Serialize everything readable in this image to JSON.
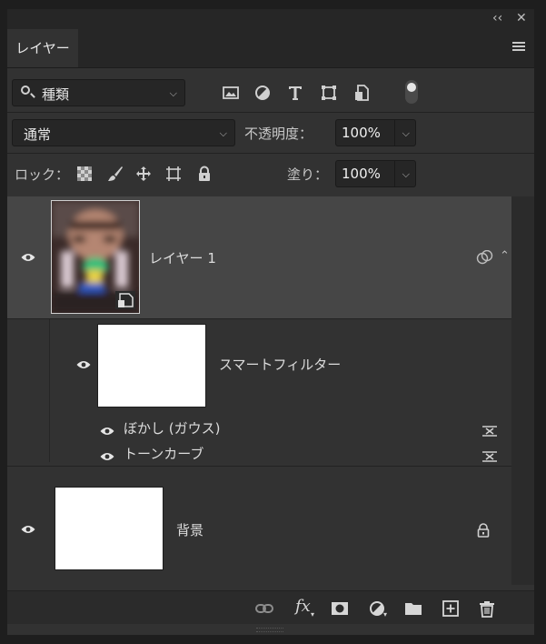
{
  "window": {
    "collapse_glyph": "‹‹",
    "close_glyph": "✕"
  },
  "tab": {
    "label": "レイヤー"
  },
  "filter": {
    "kind_label": "種類",
    "icons": [
      "image-filter-icon",
      "adjustment-filter-icon",
      "type-filter-icon",
      "shape-filter-icon",
      "smart-object-filter-icon"
    ]
  },
  "blend": {
    "mode": "通常",
    "opacity_label": "不透明度：",
    "opacity_value": "100%"
  },
  "lock": {
    "label": "ロック：",
    "fill_label": "塗り：",
    "fill_value": "100%",
    "icons": [
      "lock-transparent-pixels-icon",
      "lock-image-pixels-icon",
      "lock-position-icon",
      "lock-artboard-icon",
      "lock-all-icon"
    ]
  },
  "layers": [
    {
      "name": "レイヤー 1",
      "visible": true,
      "type": "smart-object",
      "selected": true
    },
    {
      "name": "スマートフィルター",
      "visible": true,
      "type": "smart-filter-mask"
    },
    {
      "name": "ぼかし (ガウス)",
      "visible": true,
      "type": "filter"
    },
    {
      "name": "トーンカーブ",
      "visible": true,
      "type": "filter"
    },
    {
      "name": "背景",
      "visible": true,
      "type": "background",
      "locked": true
    }
  ],
  "bottom_bar": {
    "fx_label": "fx",
    "icons": [
      "link-layers-icon",
      "fx-icon",
      "add-mask-icon",
      "new-adjustment-layer-icon",
      "new-group-icon",
      "new-layer-icon",
      "delete-icon"
    ]
  },
  "colors": {
    "panel": "#323232",
    "selected_row": "#464646",
    "field": "#262626"
  }
}
